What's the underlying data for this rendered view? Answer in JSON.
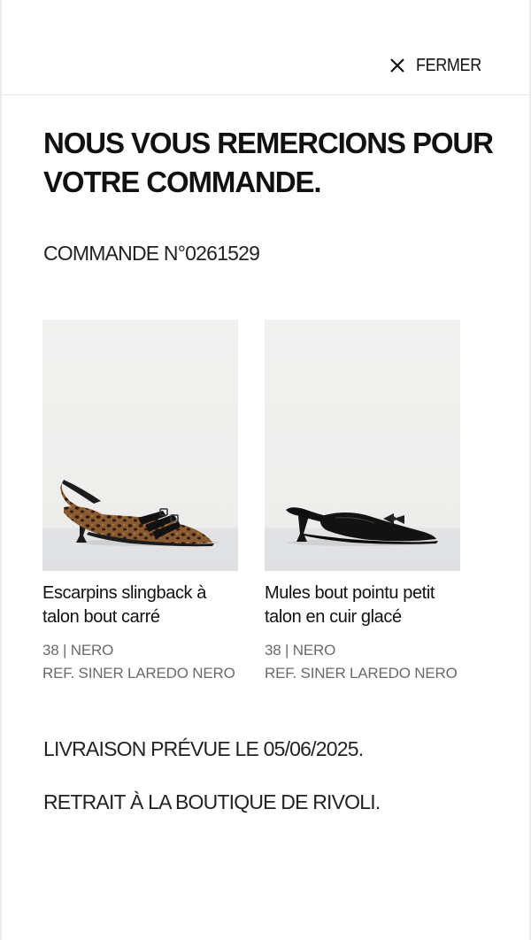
{
  "header": {
    "close_label": "FERMER",
    "close_icon": "close-icon"
  },
  "confirmation": {
    "title": "NOUS VOUS REMERCIONS POUR VOTRE COMMANDE.",
    "order_number": "COMMANDE N°0261529"
  },
  "products": [
    {
      "name": "Escarpins slingback à talon bout carré",
      "variant": "38 | NERO",
      "ref": "REF. SINER LAREDO NERO",
      "image": "leopard-slingback-pump"
    },
    {
      "name": "Mules bout pointu petit talon en cuir glacé",
      "variant": "38 | NERO",
      "ref": "REF. SINER LAREDO NERO",
      "image": "black-leather-mule"
    }
  ],
  "delivery": {
    "expected": "LIVRAISON PRÉVUE LE 05/06/2025.",
    "pickup": "RETRAIT À LA BOUTIQUE DE RIVOLI."
  },
  "colors": {
    "text": "#111111",
    "secondary_text": "#6a6a6a",
    "image_background": "#f0f0ef",
    "divider": "#efefef"
  }
}
